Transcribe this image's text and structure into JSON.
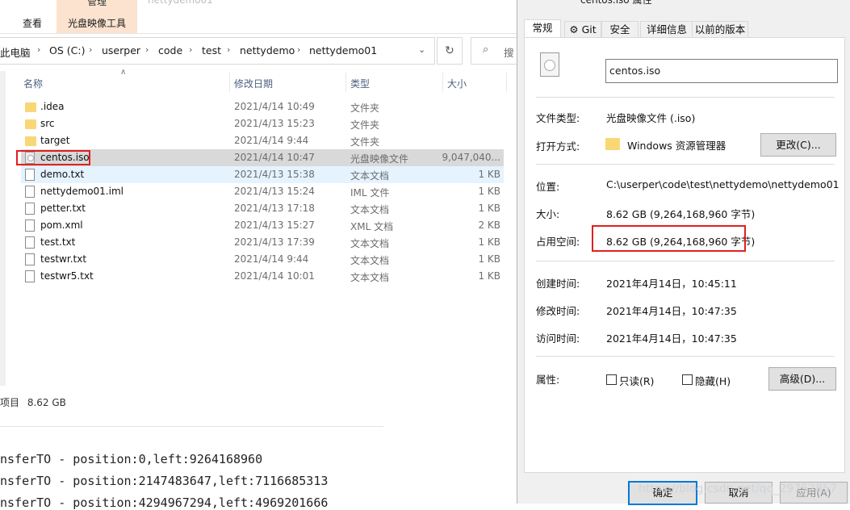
{
  "explorer": {
    "window_title": "nettydemo01",
    "ribbon": {
      "context_group_label": "管理",
      "context_tab_label": "光盘映像工具",
      "view_tab_label": "查看"
    },
    "address": {
      "crumbs": [
        "此电脑",
        "OS (C:)",
        "userper",
        "code",
        "test",
        "nettydemo",
        "nettydemo01"
      ],
      "search_placeholder": "搜"
    },
    "columns": {
      "name": "名称",
      "date": "修改日期",
      "type": "类型",
      "size": "大小"
    },
    "files": [
      {
        "name": ".idea",
        "date": "2021/4/14 10:49",
        "type": "文件夹",
        "size": "",
        "icon": "folder-icon"
      },
      {
        "name": "src",
        "date": "2021/4/13 15:23",
        "type": "文件夹",
        "size": "",
        "icon": "folder-icon"
      },
      {
        "name": "target",
        "date": "2021/4/14 9:44",
        "type": "文件夹",
        "size": "",
        "icon": "folder-icon"
      },
      {
        "name": "centos.iso",
        "date": "2021/4/14 10:47",
        "type": "光盘映像文件",
        "size": "9,047,040...",
        "icon": "disc-image-icon"
      },
      {
        "name": "demo.txt",
        "date": "2021/4/13 15:38",
        "type": "文本文档",
        "size": "1 KB",
        "icon": "text-file-icon"
      },
      {
        "name": "nettydemo01.iml",
        "date": "2021/4/13 15:24",
        "type": "IML 文件",
        "size": "1 KB",
        "icon": "file-icon"
      },
      {
        "name": "petter.txt",
        "date": "2021/4/13 17:18",
        "type": "文本文档",
        "size": "1 KB",
        "icon": "text-file-icon"
      },
      {
        "name": "pom.xml",
        "date": "2021/4/13 15:27",
        "type": "XML 文档",
        "size": "2 KB",
        "icon": "xml-file-icon"
      },
      {
        "name": "test.txt",
        "date": "2021/4/13 17:39",
        "type": "文本文档",
        "size": "1 KB",
        "icon": "text-file-icon"
      },
      {
        "name": "testwr.txt",
        "date": "2021/4/14 9:44",
        "type": "文本文档",
        "size": "1 KB",
        "icon": "text-file-icon"
      },
      {
        "name": "testwr5.txt",
        "date": "2021/4/14 10:01",
        "type": "文本文档",
        "size": "1 KB",
        "icon": "text-file-icon"
      }
    ],
    "status": {
      "selection_prefix": "项目",
      "selection_size": "8.62 GB"
    }
  },
  "console": {
    "lines": [
      "nsferTO - position:0,left:9264168960",
      "nsferTO - position:2147483647,left:7116685313",
      "nsferTO - position:4294967294,left:4969201666"
    ]
  },
  "properties": {
    "title": "centos.iso 属性",
    "tabs": [
      "常规",
      "Git",
      "安全",
      "详细信息",
      "以前的版本"
    ],
    "filename": "centos.iso",
    "labels": {
      "file_type": "文件类型:",
      "opens_with": "打开方式:",
      "location": "位置:",
      "size": "大小:",
      "size_on_disk": "占用空间:",
      "created": "创建时间:",
      "modified": "修改时间:",
      "accessed": "访问时间:",
      "attributes": "属性:"
    },
    "values": {
      "file_type": "光盘映像文件 (.iso)",
      "opens_with": "Windows 资源管理器",
      "location": "C:\\userper\\code\\test\\nettydemo\\nettydemo01",
      "size": "8.62 GB (9,264,168,960 字节)",
      "size_on_disk": "8.62 GB (9,264,168,960 字节)",
      "created": "2021年4月14日，10:45:11",
      "modified": "2021年4月14日，10:47:35",
      "accessed": "2021年4月14日，10:47:35"
    },
    "buttons": {
      "change": "更改(C)...",
      "advanced": "高级(D)...",
      "ok": "确定",
      "cancel": "取消",
      "apply": "应用(A)"
    },
    "attributes": {
      "readonly": "只读(R)",
      "hidden": "隐藏(H)"
    },
    "watermark": "https://blog.csdn.net/qq_29752857"
  },
  "colors": {
    "highlight_border": "#e02020",
    "selected_row": "#d9d9d9",
    "ribbon_context": "#fbe3d0"
  }
}
